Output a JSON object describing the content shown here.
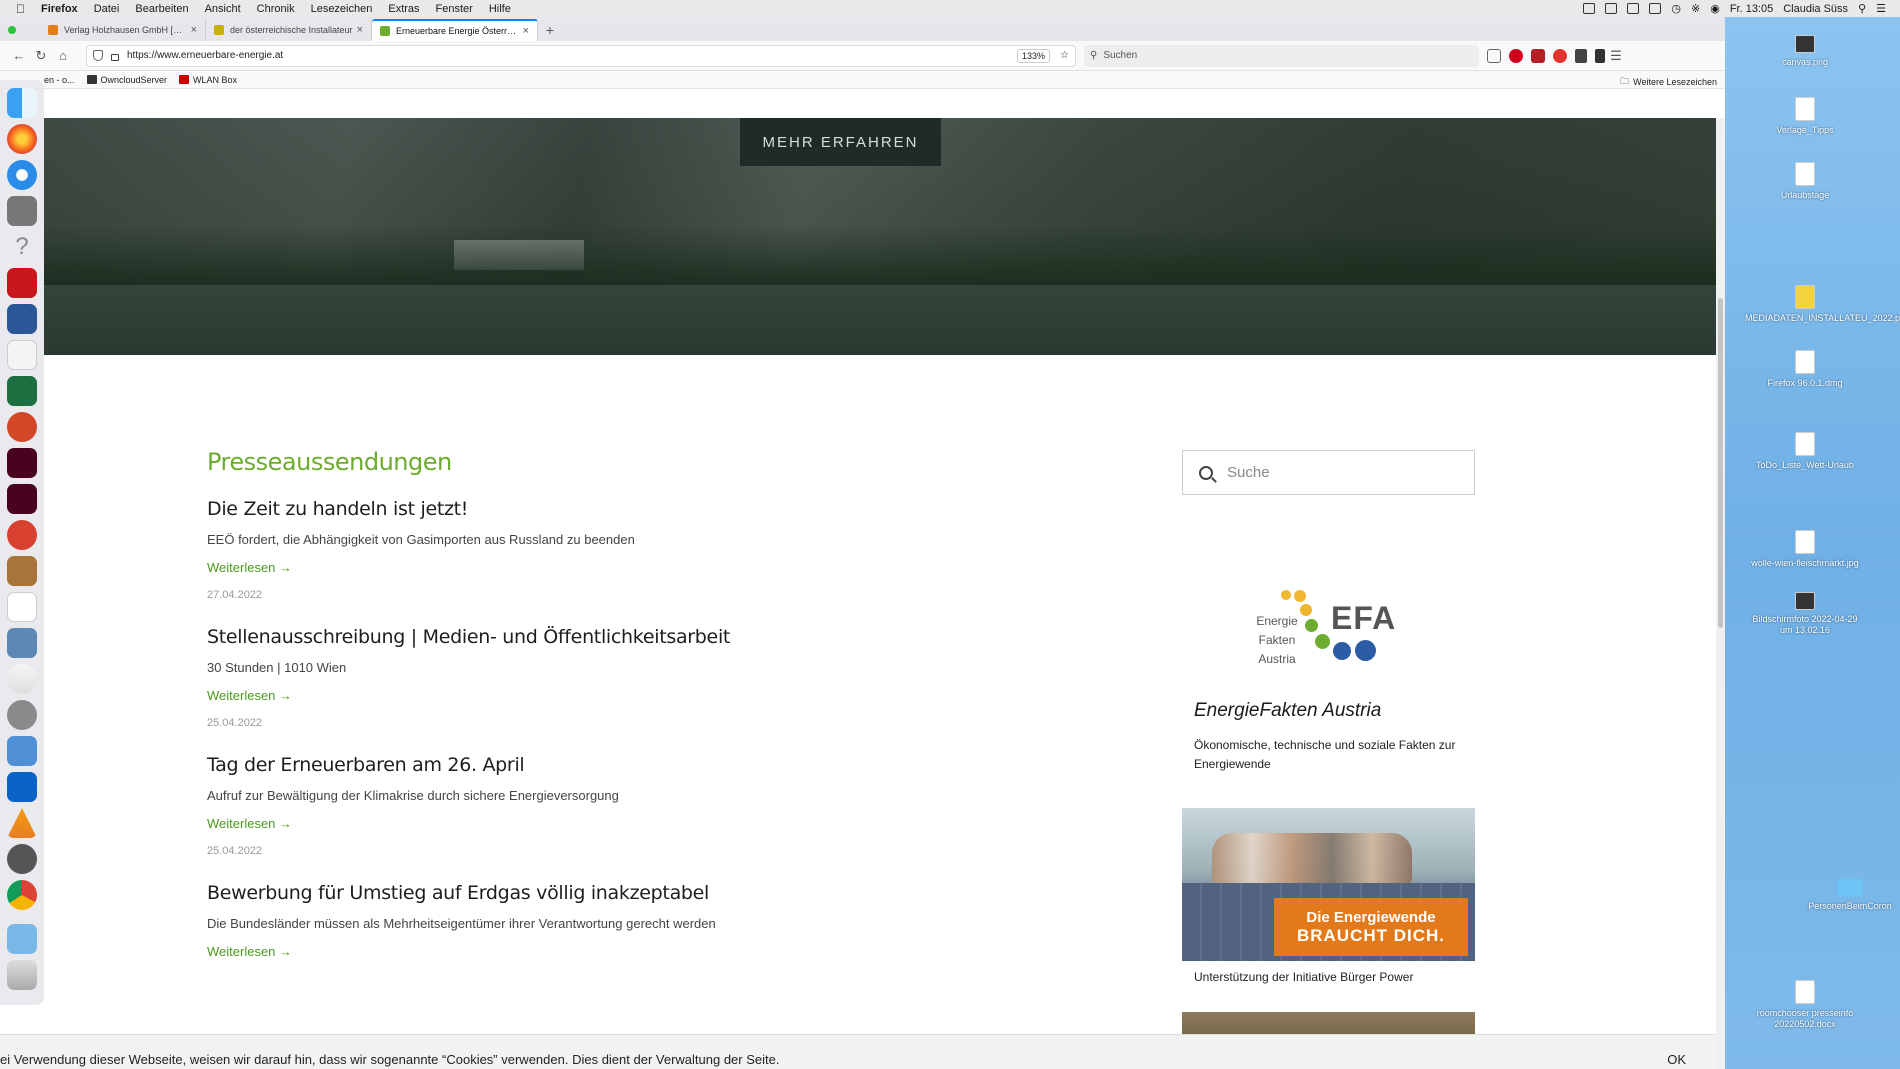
{
  "menubar": {
    "app": "Firefox",
    "items": [
      "Datei",
      "Bearbeiten",
      "Ansicht",
      "Chronik",
      "Lesezeichen",
      "Extras",
      "Fenster",
      "Hilfe"
    ],
    "clock": "Fr. 13:05",
    "user": "Claudia Süss"
  },
  "tabs": [
    {
      "title": "Verlag Holzhausen GmbH [Prod",
      "favicon_color": "#e2801c"
    },
    {
      "title": "der österreichische Installateur",
      "favicon_color": "#c8b400"
    },
    {
      "title": "Erneuerbare Energie Österreich",
      "favicon_color": "#6cac2e",
      "active": true
    }
  ],
  "navbar": {
    "url": "https://www.erneuerbare-energie.at",
    "zoom": "133%",
    "search_placeholder": "Suchen"
  },
  "bookmarks": {
    "items": [
      "en - o...",
      "OwncloudServer",
      "WLAN Box"
    ],
    "more": "Weitere Lesezeichen"
  },
  "hero": {
    "button": "MEHR ERFAHREN"
  },
  "content": {
    "section_title": "Presseaussendungen",
    "read_more": "Weiterlesen →",
    "articles": [
      {
        "title": "Die Zeit zu handeln ist jetzt!",
        "subtitle": "EEÖ fordert, die Abhängigkeit von Gasimporten aus Russland zu beenden",
        "date": "27.04.2022"
      },
      {
        "title": "Stellenausschreibung | Medien- und Öffentlichkeitsarbeit",
        "subtitle": "30 Stunden | 1010 Wien",
        "date": "25.04.2022"
      },
      {
        "title": "Tag der Erneuerbaren am 26. April",
        "subtitle": "Aufruf zur Bewältigung der Klimakrise durch sichere Energieversorgung",
        "date": "25.04.2022"
      },
      {
        "title": "Bewerbung für Umstieg auf Erdgas völlig inakzeptabel",
        "subtitle": "Die Bundesländer müssen als Mehrheitseigentümer ihrer Verantwortung gerecht werden",
        "date": ""
      }
    ]
  },
  "sidebar": {
    "search_placeholder": "Suche",
    "efa_logo_label_1": "Energie",
    "efa_logo_label_2": "Fakten",
    "efa_logo_label_3": "Austria",
    "efa_logo_abbr": "EFA",
    "efa_title": "EnergieFakten Austria",
    "efa_desc": "Ökonomische, technische und soziale Fakten zur Energiewende",
    "promo_line1": "Die Energiewende",
    "promo_line2": "BRAUCHT DICH.",
    "promo_caption": "Unterstützung der Initiative Bürger Power"
  },
  "cookie": {
    "text": "ei Verwendung dieser Webseite, weisen wir darauf hin, dass wir sogenannte “Cookies” verwenden. Dies dient der Verwaltung der Seite.",
    "ok": "OK"
  },
  "desktop": {
    "icons": [
      "canvas.png",
      "Verlage_Tipps",
      "Urlaubstage",
      "MEDIADATEN_INSTALLATEU_2022.pdf",
      "Firefox 96.0.1.dmg",
      "ToDo_Liste_Wett-Urlaub",
      "wolle-wien-fleischmarkt.jpg",
      "Bildschirmfoto 2022-04-29 um 13.02.16",
      "PersonenBeimCoron",
      "roomchooser presseinfo 20220502.docx"
    ],
    "partial_label": "ation"
  },
  "colors": {
    "accent_green": "#6cac2e",
    "link_green": "#4a9a1a",
    "hero_button_bg": "#1f2a29",
    "promo_orange": "#e27a1c"
  }
}
